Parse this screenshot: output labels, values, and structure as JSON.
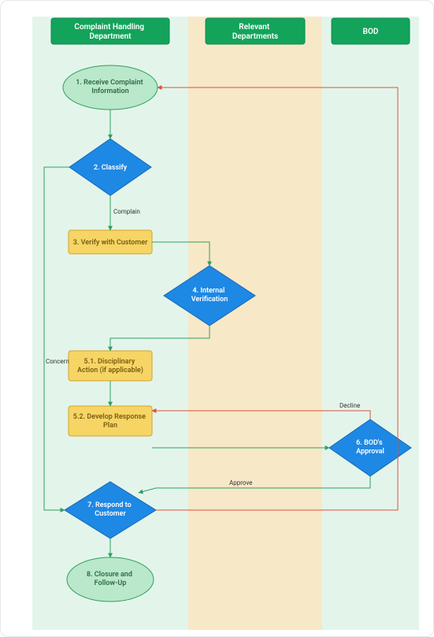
{
  "lanes": {
    "complaint": "Complaint Handling Department",
    "relevant": "Relevant Departments",
    "bod": "BOD"
  },
  "nodes": {
    "n1": "1. Receive Complaint Information",
    "n2": "2. Classify",
    "n3": "3. Verify with Customer",
    "n4": "4. Internal Verification",
    "n51": "5.1. Disciplinary Action (if applicable)",
    "n52": "5.2. Develop Response Plan",
    "n6": "6. BOD's Approval",
    "n7": "7. Respond to Customer",
    "n8": "8. Closure and Follow-Up"
  },
  "edges": {
    "complain": "Complain",
    "concern": "Concern",
    "approve": "Approve",
    "decline": "Decline"
  }
}
